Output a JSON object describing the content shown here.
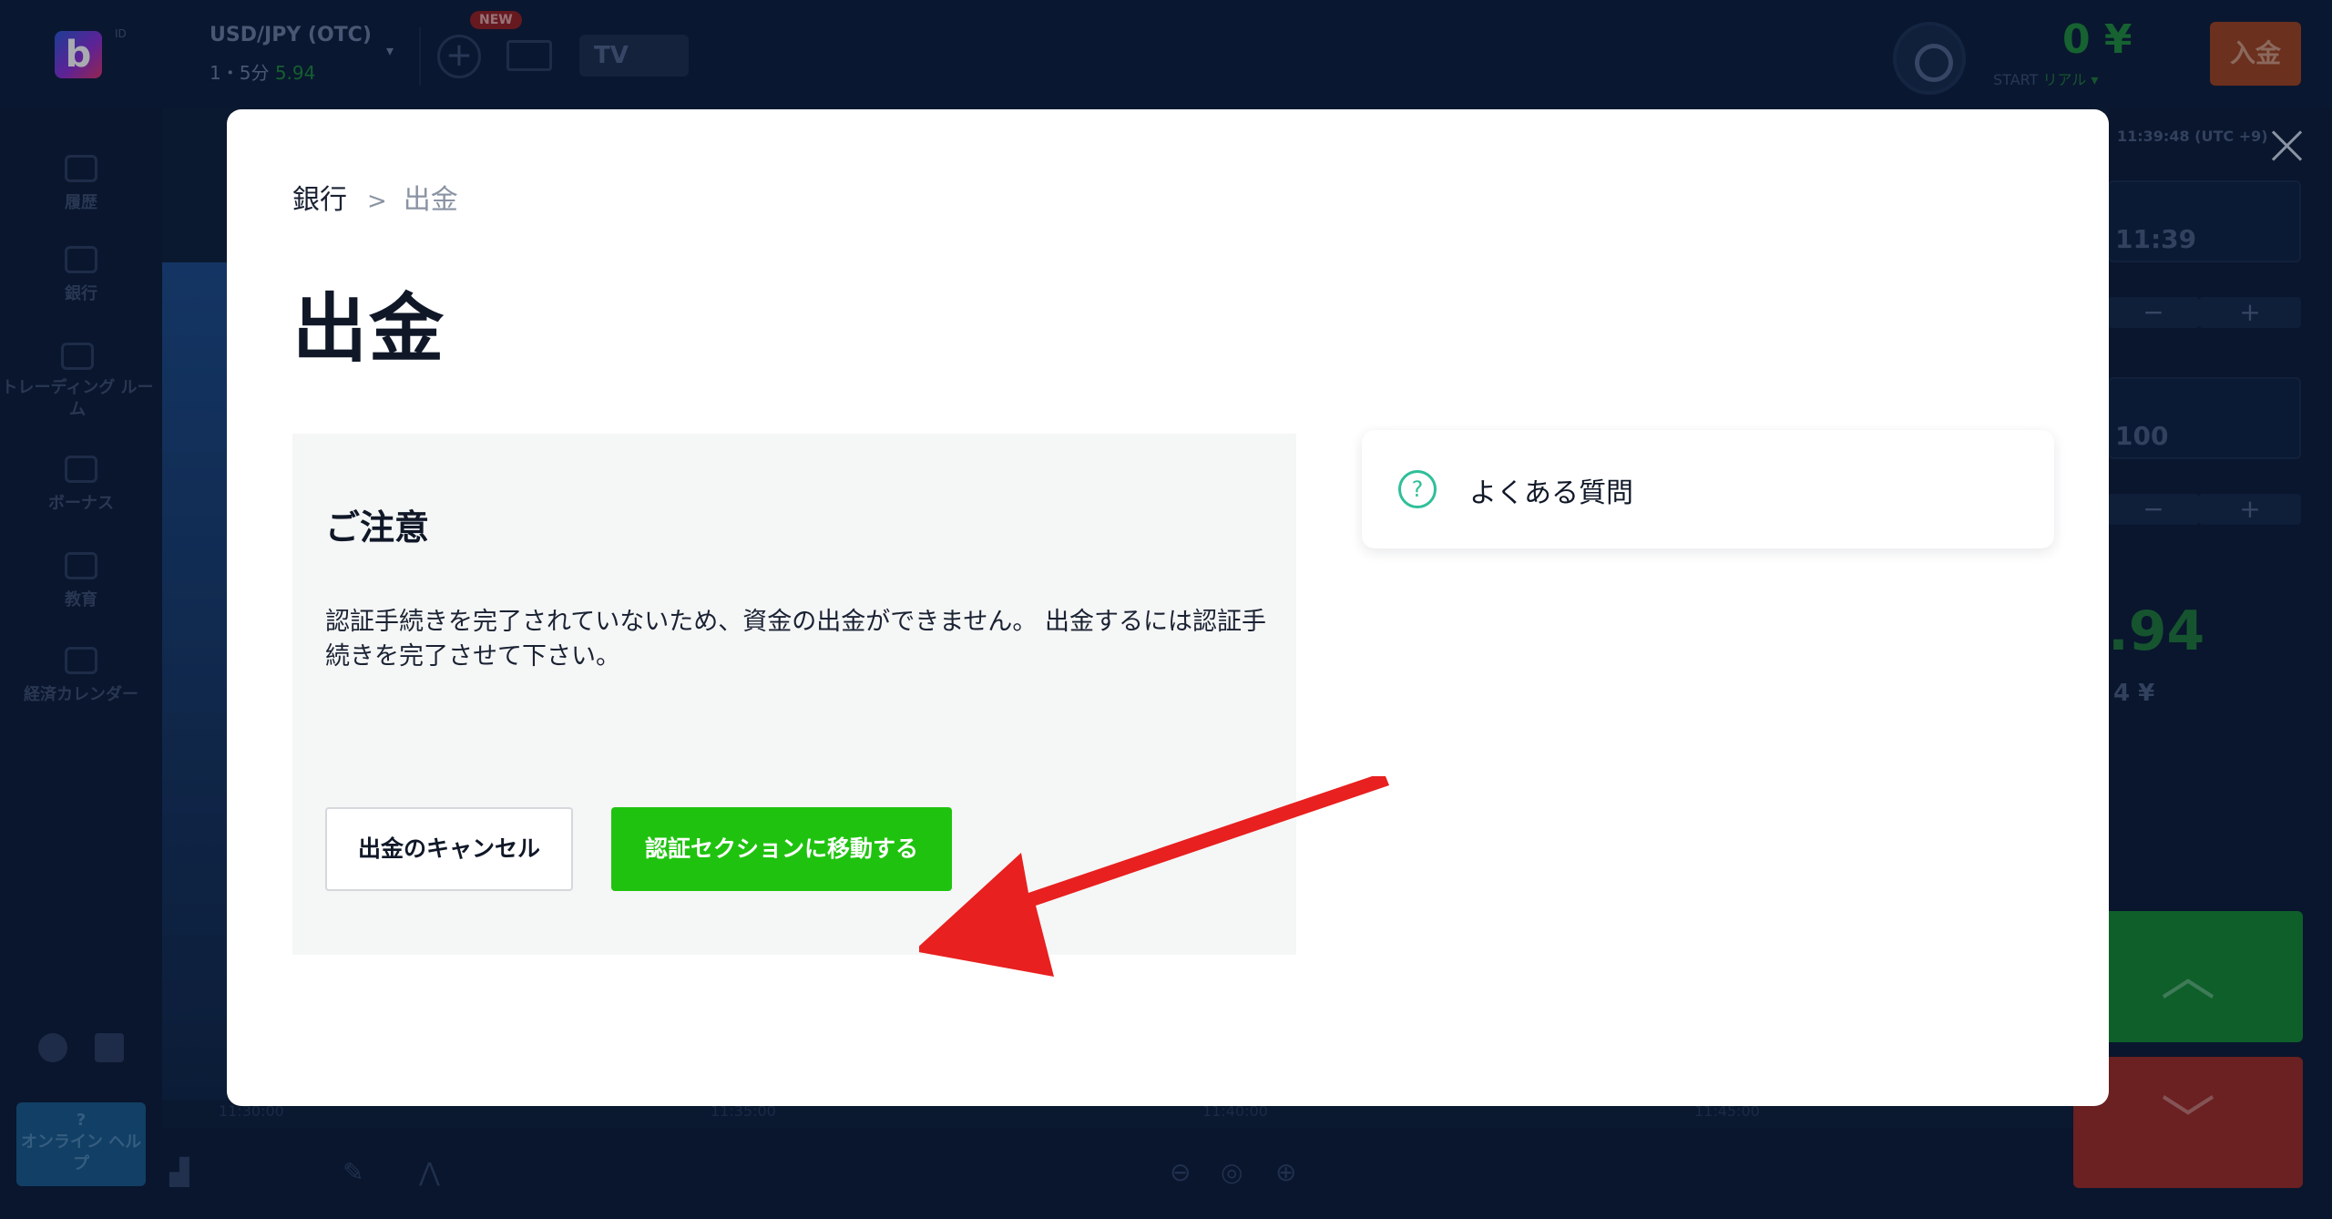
{
  "background": {
    "logo_letter": "b",
    "logo_sup": "ID",
    "asset": "USD/JPY (OTC)",
    "asset_sub_prefix": "1・5分",
    "asset_sub_value": "5.94",
    "new_badge": "NEW",
    "tv_label": "TV",
    "balance": "0 ¥",
    "balance_sub": "START",
    "balance_sub_value": "リアル ▾",
    "deposit_label": "入金",
    "sidebar": [
      {
        "label": "履歴"
      },
      {
        "label": "銀行"
      },
      {
        "label": "トレーディング ルーム"
      },
      {
        "label": "ボーナス"
      },
      {
        "label": "教育"
      },
      {
        "label": "経済カレンダー"
      }
    ],
    "help_label": "オンライン ヘルプ",
    "x_ticks": [
      "11:30:00",
      "11:35:00",
      "11:40:00",
      "11:45:00"
    ],
    "right_panel": {
      "time_header": "11:39:48 (UTC +9)",
      "time_value": "11:39",
      "amount_value": "100",
      "payout_value": ".94",
      "payout_sub": "4 ¥"
    }
  },
  "modal": {
    "breadcrumb": {
      "parent": "銀行",
      "separator": ">",
      "current": "出金"
    },
    "title": "出金",
    "notice": {
      "title": "ご注意",
      "text": "認証手続きを完了されていないため、資金の出金ができません。 出金するには認証手続きを完了させて下さい。",
      "cancel_label": "出金のキャンセル",
      "verify_label": "認証セクションに移動する"
    },
    "faq": {
      "icon": "?",
      "label": "よくある質問"
    }
  },
  "colors": {
    "verify_green": "#1fc30f",
    "arrow_red": "#e8201f",
    "faq_icon_teal": "#2fbf9a"
  }
}
